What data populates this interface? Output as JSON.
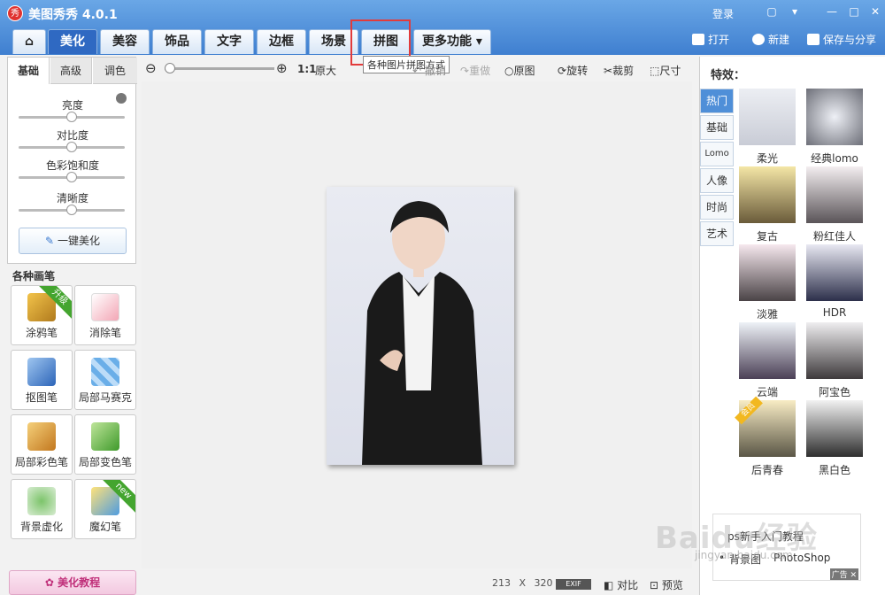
{
  "app": {
    "title": "美图秀秀 4.0.1",
    "logo": "秀",
    "login": "登录"
  },
  "nav": {
    "tabs": [
      "美化",
      "美容",
      "饰品",
      "文字",
      "边框",
      "场景",
      "拼图",
      "更多功能"
    ],
    "active": "美化"
  },
  "top_tools": {
    "open": "打开",
    "new": "新建",
    "save": "保存与分享"
  },
  "tooltip": "各种图片拼图方式",
  "left": {
    "subtabs": [
      "基础",
      "高级",
      "调色"
    ],
    "sliders": [
      "亮度",
      "对比度",
      "色彩饱和度",
      "清晰度"
    ],
    "one_click": "一键美化",
    "pens_title": "各种画笔",
    "pens": [
      {
        "label": "涂鸦笔",
        "badge": "升级"
      },
      {
        "label": "消除笔",
        "badge": ""
      },
      {
        "label": "抠图笔",
        "badge": ""
      },
      {
        "label": "局部马赛克",
        "badge": ""
      },
      {
        "label": "局部彩色笔",
        "badge": ""
      },
      {
        "label": "局部变色笔",
        "badge": ""
      },
      {
        "label": "背景虚化",
        "badge": ""
      },
      {
        "label": "魔幻笔",
        "badge": "new"
      }
    ],
    "tutorial": "美化教程"
  },
  "canvas_toolbar": {
    "zoom_ratio": "1:1",
    "original_size": "原大",
    "undo": "撤销",
    "redo": "重做",
    "original": "原图",
    "rotate": "旋转",
    "crop": "裁剪",
    "resize": "尺寸"
  },
  "status": {
    "width": "213",
    "x": "X",
    "height": "320",
    "exif": "EXIF",
    "compare": "对比",
    "preview": "预览"
  },
  "effects": {
    "title": "特效：",
    "categories": [
      "热门",
      "基础",
      "Lomo",
      "人像",
      "时尚",
      "艺术"
    ],
    "items": [
      "柔光",
      "经典lomo",
      "复古",
      "粉红佳人",
      "淡雅",
      "HDR",
      "云端",
      "阿宝色",
      "后青春",
      "黑白色"
    ],
    "member_badge": "会员"
  },
  "ad": {
    "line1": "ps新手入门教程",
    "line2": "背景图",
    "line3": "PhotoShop",
    "tag": "广告"
  },
  "watermark": {
    "brand": "Baidu经验",
    "url": "jingyan.baidu.com"
  }
}
